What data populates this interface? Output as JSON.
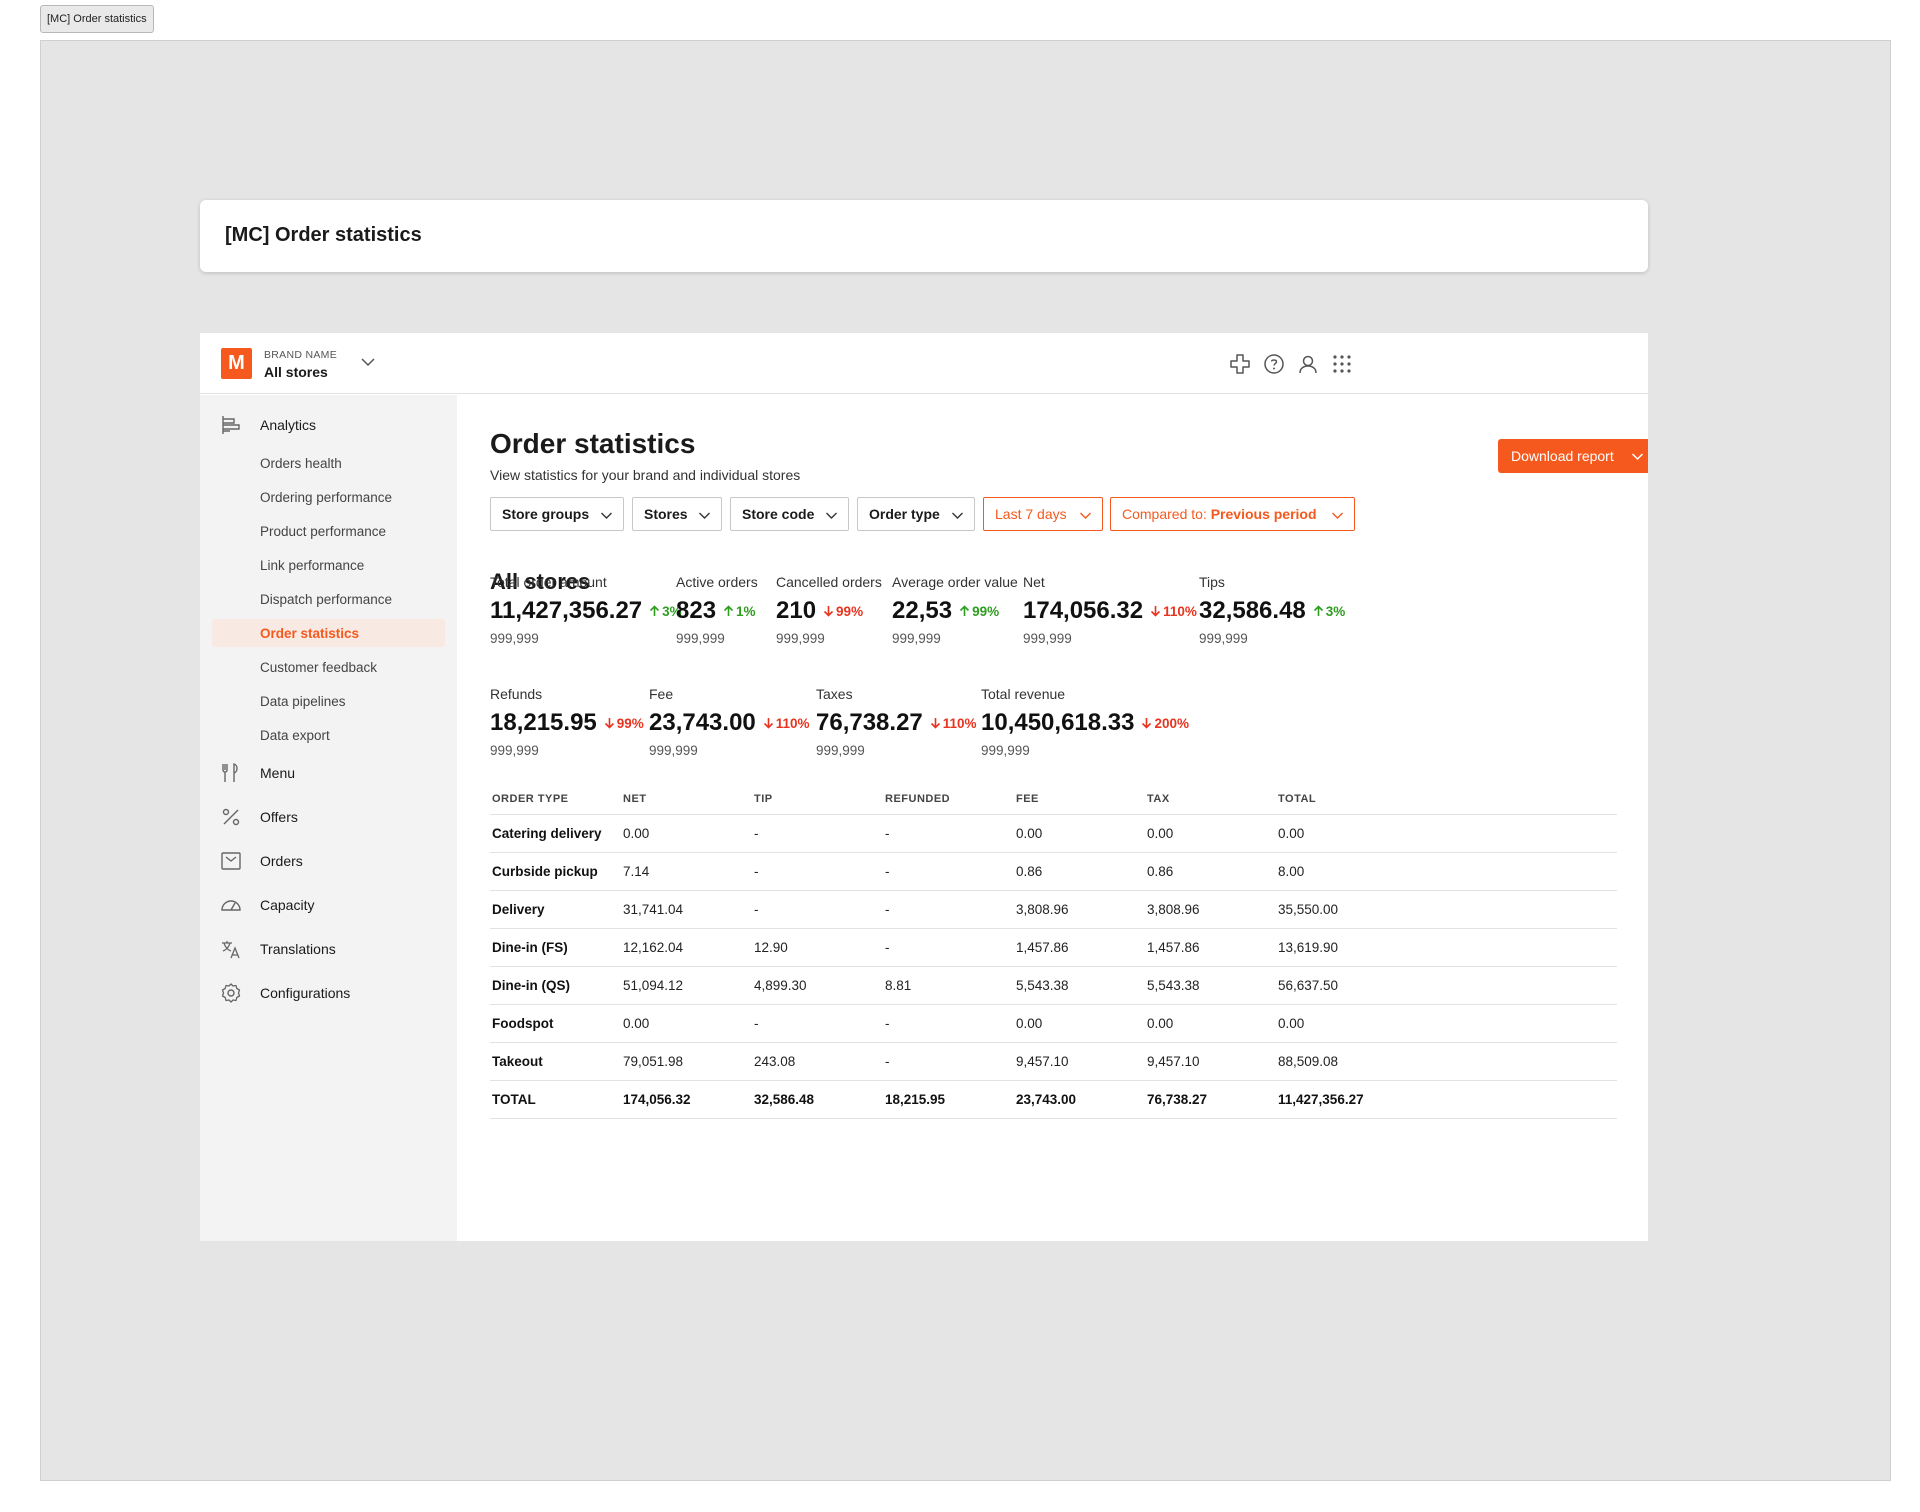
{
  "frame": {
    "tag": "[MC] Order statistics",
    "title": "[MC] Order statistics"
  },
  "brand": {
    "logo_letter": "M",
    "kicker": "BRAND NAME",
    "store": "All stores",
    "accent_color": "#f5591e"
  },
  "topbar_icons": [
    "plus-icon",
    "help-icon",
    "user-icon",
    "apps-grid-icon"
  ],
  "sidebar": {
    "analytics": {
      "label": "Analytics",
      "icon": "analytics-icon"
    },
    "analytics_sub": [
      {
        "label": "Orders health",
        "active": false
      },
      {
        "label": "Ordering performance",
        "active": false
      },
      {
        "label": "Product performance",
        "active": false
      },
      {
        "label": "Link performance",
        "active": false
      },
      {
        "label": "Dispatch performance",
        "active": false
      },
      {
        "label": "Order statistics",
        "active": true
      },
      {
        "label": "Customer feedback",
        "active": false
      },
      {
        "label": "Data pipelines",
        "active": false
      },
      {
        "label": "Data export",
        "active": false
      }
    ],
    "items": [
      {
        "label": "Menu",
        "icon": "menu-fork-knife-icon"
      },
      {
        "label": "Offers",
        "icon": "percent-icon"
      },
      {
        "label": "Orders",
        "icon": "orders-inbox-icon"
      },
      {
        "label": "Capacity",
        "icon": "gauge-icon"
      },
      {
        "label": "Translations",
        "icon": "translate-icon"
      },
      {
        "label": "Configurations",
        "icon": "gear-icon"
      }
    ]
  },
  "main": {
    "title": "Order statistics",
    "subtitle": "View statistics for your brand and individual stores",
    "download_label": "Download report",
    "filters": {
      "store_groups": "Store groups",
      "stores": "Stores",
      "store_code": "Store code",
      "order_type": "Order type",
      "date_range": "Last 7 days",
      "compare_prefix": "Compared to:",
      "compare_value": "Previous period"
    },
    "section_title": "All stores"
  },
  "metrics": [
    {
      "label": "Total order amount",
      "value": "11,427,356.27",
      "delta": "3%",
      "direction": "up",
      "compare": "999,999"
    },
    {
      "label": "Active orders",
      "value": "823",
      "delta": "1%",
      "direction": "up",
      "compare": "999,999"
    },
    {
      "label": "Cancelled orders",
      "value": "210",
      "delta": "99%",
      "direction": "down",
      "compare": "999,999"
    },
    {
      "label": "Average order value",
      "value": "22,53",
      "delta": "99%",
      "direction": "up",
      "compare": "999,999"
    },
    {
      "label": "Net",
      "value": "174,056.32",
      "delta": "110%",
      "direction": "down",
      "compare": "999,999"
    },
    {
      "label": "Tips",
      "value": "32,586.48",
      "delta": "3%",
      "direction": "up",
      "compare": "999,999"
    },
    {
      "label": "Refunds",
      "value": "18,215.95",
      "delta": "99%",
      "direction": "down",
      "compare": "999,999"
    },
    {
      "label": "Fee",
      "value": "23,743.00",
      "delta": "110%",
      "direction": "down",
      "compare": "999,999"
    },
    {
      "label": "Taxes",
      "value": "76,738.27",
      "delta": "110%",
      "direction": "down",
      "compare": "999,999"
    },
    {
      "label": "Total revenue",
      "value": "10,450,618.33",
      "delta": "200%",
      "direction": "down",
      "compare": "999,999"
    }
  ],
  "table": {
    "headers": [
      "ORDER TYPE",
      "NET",
      "TIP",
      "REFUNDED",
      "FEE",
      "TAX",
      "TOTAL"
    ],
    "rows": [
      [
        "Catering delivery",
        "0.00",
        "-",
        "-",
        "0.00",
        "0.00",
        "0.00"
      ],
      [
        "Curbside pickup",
        "7.14",
        "-",
        "-",
        "0.86",
        "0.86",
        "8.00"
      ],
      [
        "Delivery",
        "31,741.04",
        "-",
        "-",
        "3,808.96",
        "3,808.96",
        "35,550.00"
      ],
      [
        "Dine-in (FS)",
        "12,162.04",
        "12.90",
        "-",
        "1,457.86",
        "1,457.86",
        "13,619.90"
      ],
      [
        "Dine-in (QS)",
        "51,094.12",
        "4,899.30",
        "8.81",
        "5,543.38",
        "5,543.38",
        "56,637.50"
      ],
      [
        "Foodspot",
        "0.00",
        "-",
        "-",
        "0.00",
        "0.00",
        "0.00"
      ],
      [
        "Takeout",
        "79,051.98",
        "243.08",
        "-",
        "9,457.10",
        "9,457.10",
        "88,509.08"
      ],
      [
        "TOTAL",
        "174,056.32",
        "32,586.48",
        "18,215.95",
        "23,743.00",
        "76,738.27",
        "11,427,356.27"
      ]
    ]
  }
}
